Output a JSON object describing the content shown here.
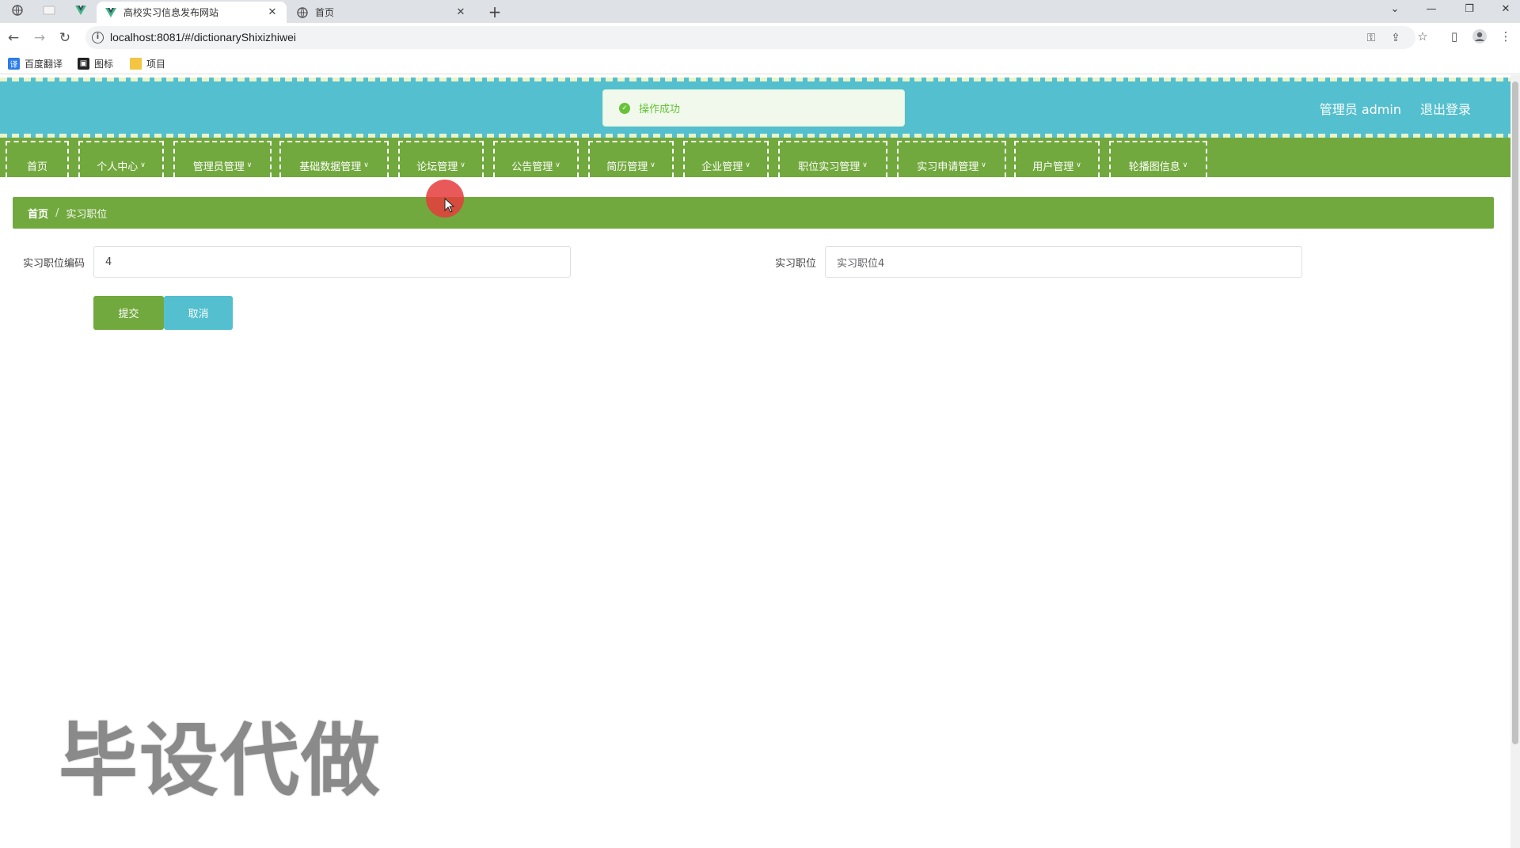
{
  "browser": {
    "tabs": [
      {
        "title": "高校实习信息发布网站",
        "active": true
      },
      {
        "title": "首页",
        "active": false
      }
    ],
    "url": "localhost:8081/#/dictionaryShixizhiwei",
    "bookmarks": [
      {
        "label": "百度翻译",
        "icon": "translate-icon"
      },
      {
        "label": "图标",
        "icon": "image-icon"
      },
      {
        "label": "项目",
        "icon": "folder-icon"
      }
    ]
  },
  "header": {
    "user_label": "管理员 admin",
    "logout_label": "退出登录",
    "bg_color": "#54bfce"
  },
  "toast": {
    "message": "操作成功",
    "color": "#67c23a"
  },
  "menu": {
    "bg_color": "#72a93e",
    "items": [
      {
        "label": "首页",
        "dropdown": false
      },
      {
        "label": "个人中心",
        "dropdown": true
      },
      {
        "label": "管理员管理",
        "dropdown": true
      },
      {
        "label": "基础数据管理",
        "dropdown": true
      },
      {
        "label": "论坛管理",
        "dropdown": true
      },
      {
        "label": "公告管理",
        "dropdown": true
      },
      {
        "label": "简历管理",
        "dropdown": true
      },
      {
        "label": "企业管理",
        "dropdown": true
      },
      {
        "label": "职位实习管理",
        "dropdown": true
      },
      {
        "label": "实习申请管理",
        "dropdown": true
      },
      {
        "label": "用户管理",
        "dropdown": true
      },
      {
        "label": "轮播图信息",
        "dropdown": true
      }
    ]
  },
  "breadcrumb": {
    "home": "首页",
    "separator": "/",
    "current": "实习职位"
  },
  "form": {
    "code_label": "实习职位编码",
    "code_value": "4",
    "name_label": "实习职位",
    "name_value": "实习职位4",
    "submit_label": "提交",
    "cancel_label": "取消",
    "submit_color": "#72a93e",
    "cancel_color": "#54bfce"
  },
  "watermark": "毕设代做"
}
